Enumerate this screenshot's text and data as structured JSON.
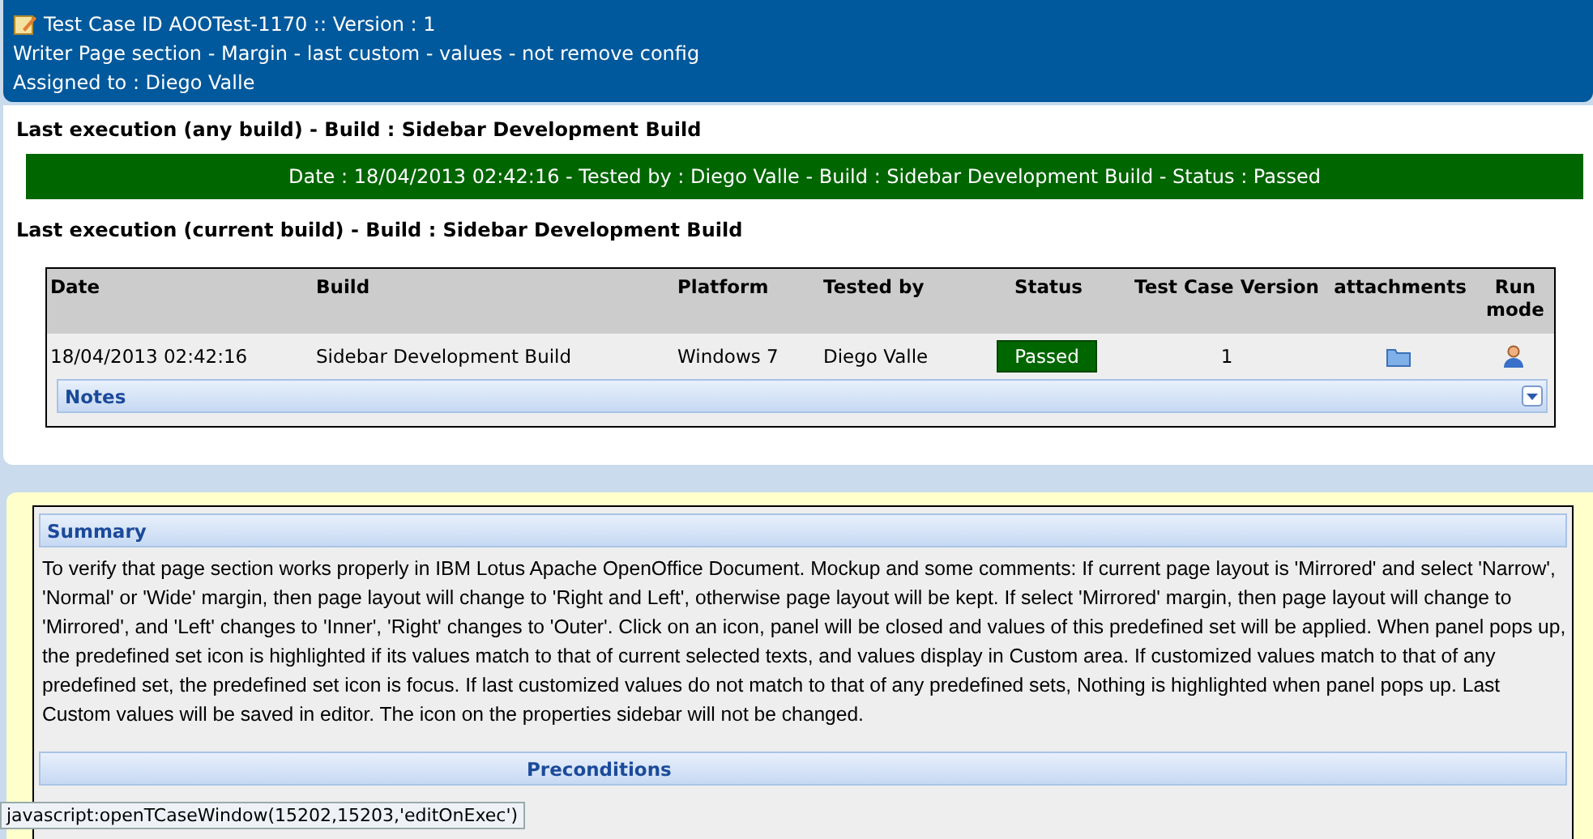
{
  "header": {
    "title": "Test Case ID AOOTest-1170 :: Version : 1",
    "name": "Writer Page section - Margin - last custom - values - not remove config",
    "assigned": "Assigned to : Diego Valle"
  },
  "last_any": {
    "heading": "Last execution (any build) - Build : Sidebar Development Build",
    "banner": "Date : 18/04/2013 02:42:16 - Tested by : Diego Valle - Build : Sidebar Development Build - Status : Passed",
    "passed": true
  },
  "last_current": {
    "heading": "Last execution (current build) - Build : Sidebar Development Build"
  },
  "table": {
    "columns": [
      "Date",
      "Build",
      "Platform",
      "Tested by",
      "Status",
      "Test Case Version",
      "attachments",
      "Run mode"
    ],
    "rows": [
      {
        "date": "18/04/2013 02:42:16",
        "build": "Sidebar Development Build",
        "platform": "Windows 7",
        "tested_by": "Diego Valle",
        "status": "Passed",
        "passed": true,
        "version": "1"
      }
    ],
    "notes": {
      "label": "Notes",
      "expanded": false
    }
  },
  "summary": {
    "label": "Summary",
    "text": "To verify that page section works properly in IBM Lotus Apache OpenOffice Document. Mockup and some comments: If current page layout is 'Mirrored' and select 'Narrow', 'Normal' or 'Wide' margin, then page layout will change to 'Right and Left', otherwise page layout will be kept. If select 'Mirrored' margin, then page layout will change to 'Mirrored', and 'Left' changes to 'Inner', 'Right' changes to 'Outer'. Click on an icon, panel will be closed and values of this predefined set will be applied. When panel pops up, the predefined set icon is highlighted if its values match to that of current selected texts, and values display in Custom area. If customized values match to that of any predefined set, the predefined set icon is focus. If last customized values do not match to that of any predefined sets, Nothing is highlighted when panel pops up. Last Custom values will be saved in editor. The icon on the properties sidebar will not be changed."
  },
  "preconditions": {
    "label": "Preconditions"
  },
  "status_bar": "javascript:openTCaseWindow(15202,15203,'editOnExec')"
}
